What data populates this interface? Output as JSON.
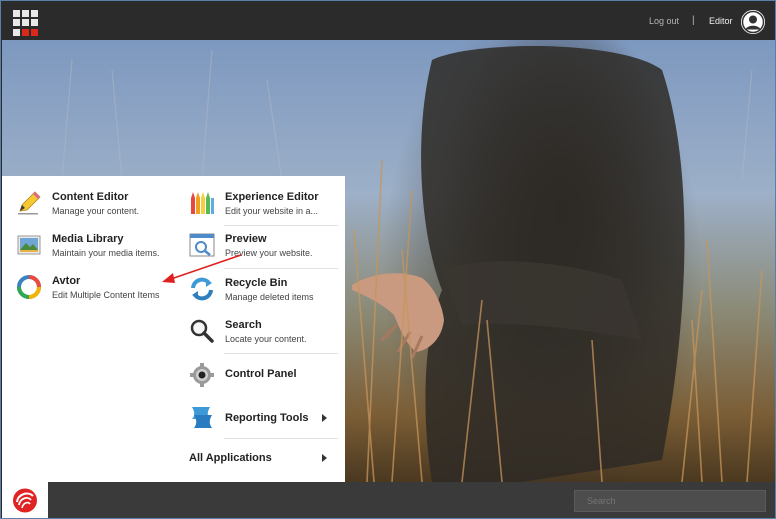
{
  "header": {
    "logout_label": "Log out",
    "separator": "|",
    "user_name": "Editor"
  },
  "menu": {
    "left_column": [
      {
        "title": "Content Editor",
        "desc": "Manage your content.",
        "icon": "pencil-icon"
      },
      {
        "title": "Media Library",
        "desc": "Maintain your media items.",
        "icon": "image-icon"
      },
      {
        "title": "Avtor",
        "desc": "Edit Multiple Content Items",
        "icon": "avtor-ring-icon"
      }
    ],
    "right_column": [
      {
        "title": "Experience Editor",
        "desc": "Edit your website in a...",
        "icon": "colored-pencils-icon"
      },
      {
        "title": "Preview",
        "desc": "Preview your website.",
        "icon": "preview-window-icon"
      },
      {
        "title": "Recycle Bin",
        "desc": "Manage deleted items",
        "icon": "recycle-icon"
      },
      {
        "title": "Search",
        "desc": "Locate your content.",
        "icon": "magnifier-icon"
      },
      {
        "title": "Control Panel",
        "desc": "",
        "icon": "gear-icon"
      },
      {
        "title": "Reporting Tools",
        "desc": "",
        "icon": "reporting-icon"
      }
    ],
    "all_apps_label": "All Applications"
  },
  "footer": {
    "search_placeholder": "Search"
  },
  "colors": {
    "header_bg": "#2b2b2b",
    "accent_red": "#d9291c",
    "annotation_arrow": "#e02020"
  }
}
